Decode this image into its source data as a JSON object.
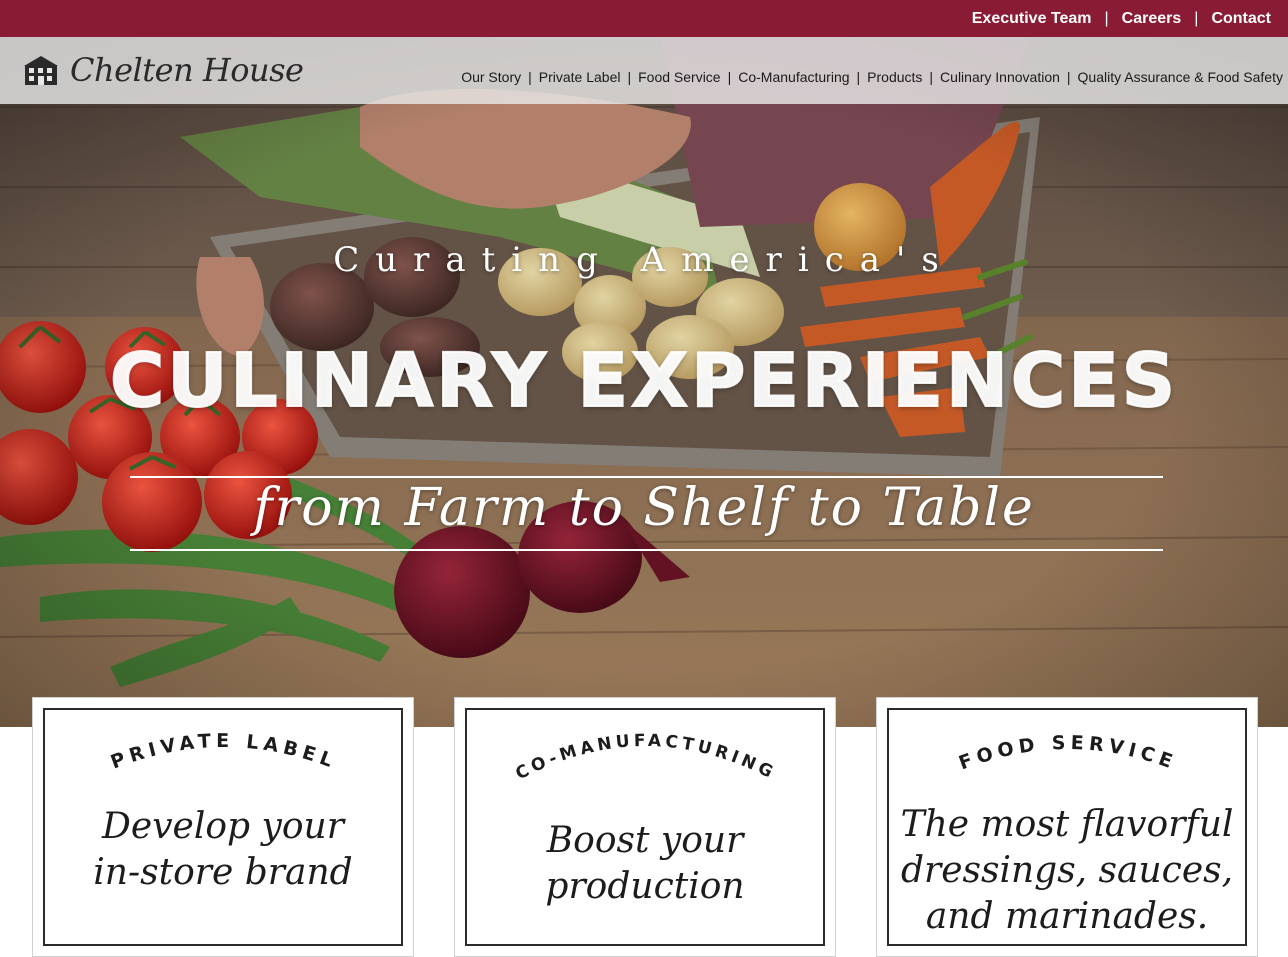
{
  "topnav": {
    "items": [
      "Executive Team",
      "Careers",
      "Contact"
    ],
    "separator": "|"
  },
  "brand": {
    "name": "Chelten House",
    "logo_icon": "house-icon"
  },
  "mainnav": {
    "items": [
      "Our Story",
      "Private Label",
      "Food Service",
      "Co-Manufacturing",
      "Products",
      "Culinary Innovation",
      "Quality Assurance & Food Safety"
    ],
    "separator": "|"
  },
  "hero": {
    "line1": "Curating America's",
    "line2": "CULINARY EXPERIENCES",
    "line3": "from Farm to Shelf to Table"
  },
  "cards": [
    {
      "title": "PRIVATE LABEL",
      "body": [
        "Develop your",
        "in-store brand"
      ]
    },
    {
      "title": "CO-MANUFACTURING",
      "body": [
        "Boost your",
        "production"
      ]
    },
    {
      "title": "FOOD SERVICE",
      "body": [
        "The most flavorful",
        "dressings, sauces,",
        "and marinades."
      ]
    }
  ],
  "colors": {
    "brand_red": "#8a1b34",
    "nav_bg": "#e8e8e8",
    "white": "#ffffff"
  }
}
